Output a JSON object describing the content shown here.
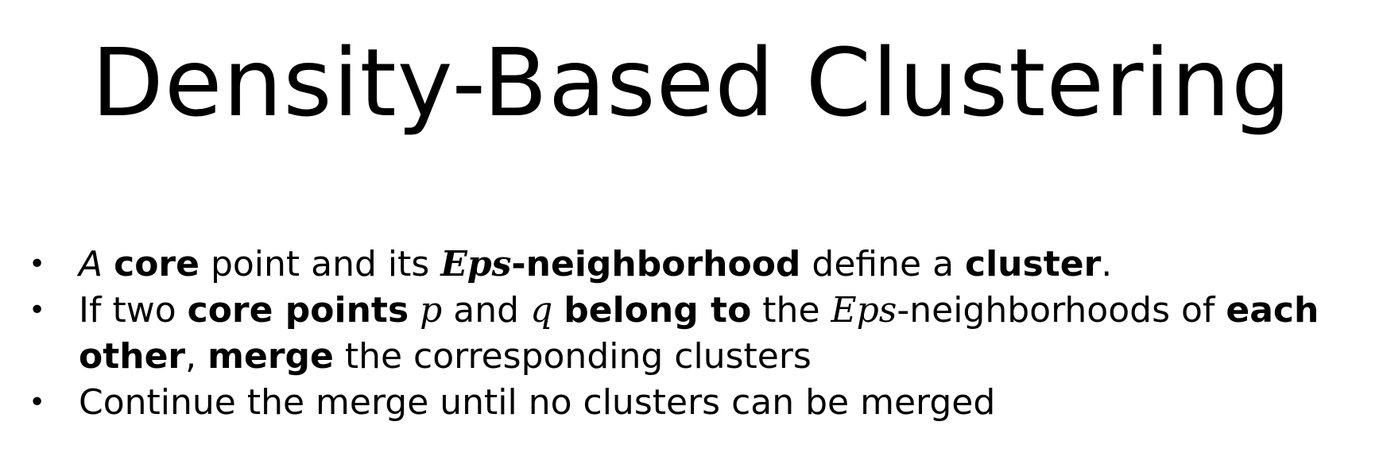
{
  "title": "Density-Based Clustering",
  "bullet_marker": "•",
  "bullets": [
    {
      "segments": [
        {
          "text": "A",
          "style": "italic"
        },
        {
          "text": " ",
          "style": "normal"
        },
        {
          "text": "core",
          "style": "bold"
        },
        {
          "text": " point and its ",
          "style": "normal"
        },
        {
          "text": "Eps",
          "style": "math-bold"
        },
        {
          "text": "-neighborhood",
          "style": "bold"
        },
        {
          "text": " define a ",
          "style": "normal"
        },
        {
          "text": "cluster",
          "style": "bold"
        },
        {
          "text": ".",
          "style": "normal"
        }
      ]
    },
    {
      "segments": [
        {
          "text": "If two ",
          "style": "normal"
        },
        {
          "text": "core points",
          "style": "bold"
        },
        {
          "text": " ",
          "style": "normal"
        },
        {
          "text": "p",
          "style": "math"
        },
        {
          "text": " and ",
          "style": "normal"
        },
        {
          "text": "q",
          "style": "math"
        },
        {
          "text": " ",
          "style": "normal"
        },
        {
          "text": "belong to",
          "style": "bold"
        },
        {
          "text": " the ",
          "style": "normal"
        },
        {
          "text": "Eps",
          "style": "math"
        },
        {
          "text": "-neighborhoods of ",
          "style": "normal"
        },
        {
          "text": "each other",
          "style": "bold"
        },
        {
          "text": ", ",
          "style": "normal"
        },
        {
          "text": "merge",
          "style": "bold"
        },
        {
          "text": " the corresponding clusters",
          "style": "normal"
        }
      ]
    },
    {
      "segments": [
        {
          "text": "Continue the merge until no clusters can be merged",
          "style": "normal"
        }
      ]
    }
  ]
}
